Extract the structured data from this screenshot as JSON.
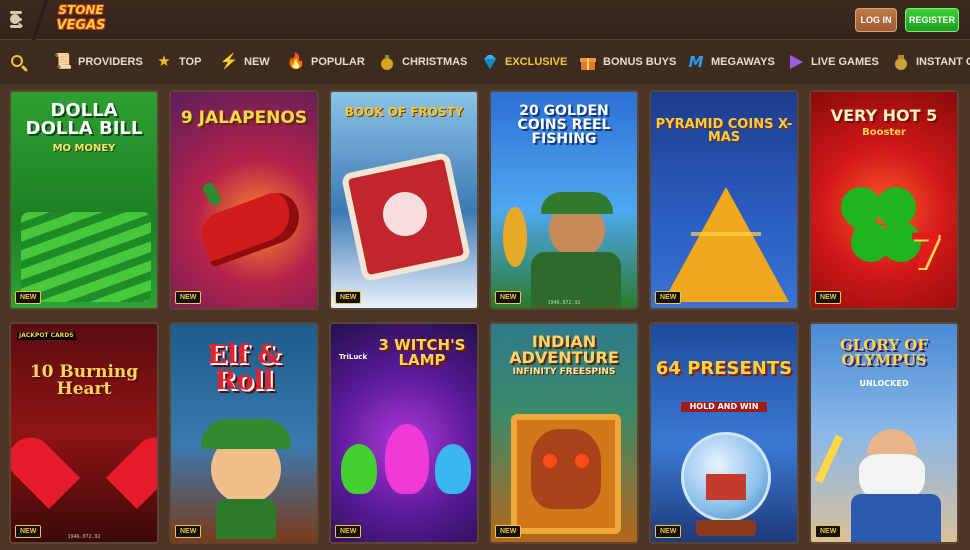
{
  "header": {
    "logo_line1": "STONE",
    "logo_line2": "VEGAS",
    "login_label": "LOG IN",
    "register_label": "REGISTER"
  },
  "categories": [
    {
      "label": "PROVIDERS",
      "icon": "scroll-icon"
    },
    {
      "label": "TOP",
      "icon": "star-icon"
    },
    {
      "label": "NEW",
      "icon": "lightning-icon"
    },
    {
      "label": "POPULAR",
      "icon": "flame-icon"
    },
    {
      "label": "CHRISTMAS",
      "icon": "ornament-icon"
    },
    {
      "label": "EXCLUSIVE",
      "icon": "diamond-icon",
      "active": true
    },
    {
      "label": "BONUS BUYS",
      "icon": "gift-icon"
    },
    {
      "label": "MEGAWAYS",
      "icon": "megaways-m-icon"
    },
    {
      "label": "LIVE GAMES",
      "icon": "play-icon"
    },
    {
      "label": "INSTANT GA",
      "icon": "money-bag-icon"
    }
  ],
  "games": [
    {
      "title": "DOLLA DOLLA BILL",
      "subtitle": "MO MONEY",
      "badge": "NEW",
      "footer": ""
    },
    {
      "title": "9 JALAPENOS",
      "subtitle": "",
      "badge": "NEW",
      "footer": ""
    },
    {
      "title": "BOOK OF FROSTY",
      "subtitle": "",
      "badge": "NEW",
      "footer": ""
    },
    {
      "title": "20 GOLDEN COINS REEL FISHING",
      "subtitle": "",
      "badge": "NEW",
      "footer": "1946.072.92"
    },
    {
      "title": "PYRAMID COINS X-MAS",
      "subtitle": "",
      "badge": "NEW",
      "footer": ""
    },
    {
      "title": "VERY HOT 5",
      "subtitle": "Booster",
      "badge": "NEW",
      "footer": ""
    },
    {
      "title": "10 Burning Heart",
      "subtitle": "JACKPOT CARDS",
      "badge": "NEW",
      "footer": "1946.072.92"
    },
    {
      "title": "Elf & Roll",
      "subtitle": "",
      "badge": "NEW",
      "footer": ""
    },
    {
      "title": "3 WITCH'S LAMP",
      "subtitle": "TriLuck",
      "badge": "NEW",
      "footer": ""
    },
    {
      "title": "INDIAN ADVENTURE",
      "subtitle": "INFINITY FREESPINS",
      "badge": "NEW",
      "footer": ""
    },
    {
      "title": "64 PRESENTS",
      "subtitle": "HOLD AND WIN",
      "badge": "NEW",
      "footer": ""
    },
    {
      "title": "GLORY OF OLYMPUS",
      "subtitle": "UNLOCKED",
      "badge": "NEW",
      "footer": ""
    }
  ],
  "colors": {
    "accent": "#f3c43a",
    "register_green": "#2bbd2a",
    "login_brown": "#b06a3e",
    "bg": "#4a3424"
  }
}
